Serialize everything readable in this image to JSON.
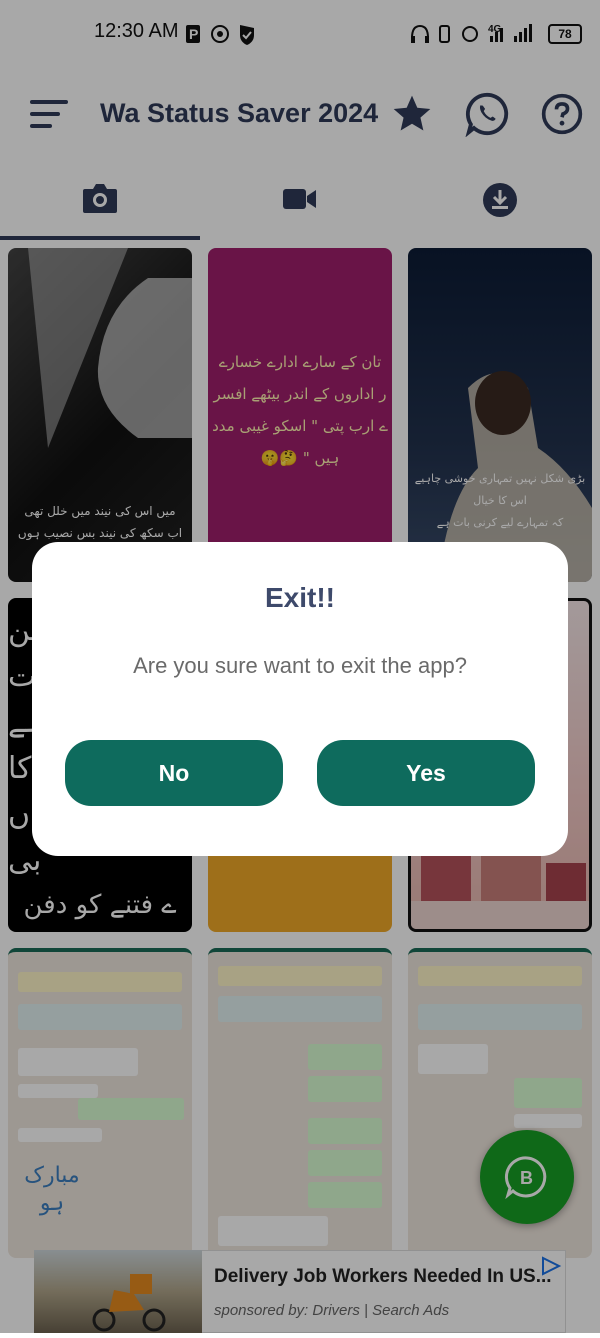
{
  "status_bar": {
    "time": "12:30 AM",
    "network": "4G",
    "battery": "78"
  },
  "app_bar": {
    "title": "Wa Status Saver 2024"
  },
  "tabs": [
    {
      "icon": "camera-icon",
      "selected": true
    },
    {
      "icon": "video-icon",
      "selected": false
    },
    {
      "icon": "download-icon",
      "selected": false
    }
  ],
  "grid": {
    "card1_lines": [
      "میں اس کی نیند میں خلل تھی",
      "اب سکھ کی نیند بس نصیب ہوں اس کو"
    ],
    "card2_lines": [
      "تان کے سارے ادارے خسارے",
      "ر اداروں کے اندر بیٹھے افسر",
      "ے ارب پتی \" اسکو غیبی مدد",
      "ہیں \" 🤔🤫"
    ],
    "card3_lines": [
      "بڑی شکل نہیں تمہاری خوشی چاہیے اس کا خیال",
      "کہ تمہارے لیے کرنی بات ہے"
    ],
    "card4_lines": [
      "ین",
      "ات",
      "ہے",
      "کا",
      "ں",
      "بی",
      "ے فتنے کو دفن"
    ],
    "card9_urdu": [
      "مبارک",
      "ہو"
    ]
  },
  "colors": {
    "accent": "#0e6b5d",
    "title": "#2f3b59",
    "fab": "#17a025"
  },
  "ad": {
    "title": "Delivery Job Workers Needed In US...",
    "sponsor": "sponsored by: Drivers | Search Ads"
  },
  "dialog": {
    "title": "Exit!!",
    "message": "Are you sure want to exit the app?",
    "no_label": "No",
    "yes_label": "Yes"
  }
}
